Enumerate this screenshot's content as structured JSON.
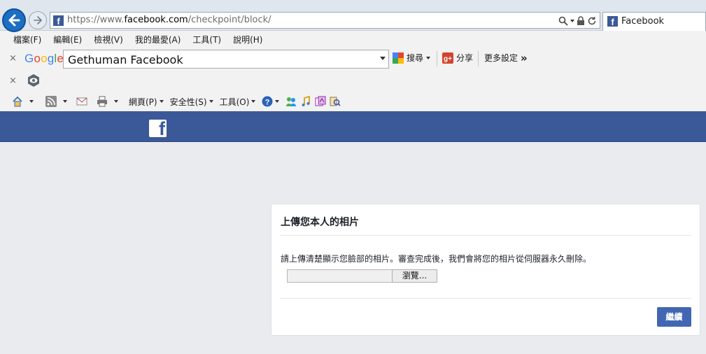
{
  "browser": {
    "url_prefix": "https://www.",
    "url_domain": "facebook.com",
    "url_path": "/checkpoint/block/",
    "tab_title": "Facebook",
    "tab_favicon": "f"
  },
  "menu": {
    "items": [
      "檔案(F)",
      "編輯(E)",
      "檢視(V)",
      "我的最愛(A)",
      "工具(T)",
      "說明(H)"
    ]
  },
  "google_toolbar": {
    "close": "×",
    "logo_letters": [
      "G",
      "o",
      "o",
      "g",
      "l",
      "e"
    ],
    "logo_colors": [
      "#4285f4",
      "#ea4335",
      "#fbbc05",
      "#4285f4",
      "#34a853",
      "#ea4335"
    ],
    "search_value": "Gethuman Facebook",
    "search_label": "搜尋",
    "share_label": "分享",
    "more_label": "更多設定",
    "more_chevron": "»"
  },
  "addon_toolbar": {
    "close": "×"
  },
  "command_bar": {
    "page_label": "網頁(P)",
    "safety_label": "安全性(S)",
    "tools_label": "工具(O)"
  },
  "facebook": {
    "logo": "f",
    "brand_color": "#3b5998",
    "button_color": "#4267b2",
    "card": {
      "title": "上傳您本人的相片",
      "description": "請上傳清楚顯示您臉部的相片。審查完成後，我們會將您的相片從伺服器永久刪除。",
      "browse_label": "瀏覽...",
      "continue_label": "繼續"
    }
  }
}
